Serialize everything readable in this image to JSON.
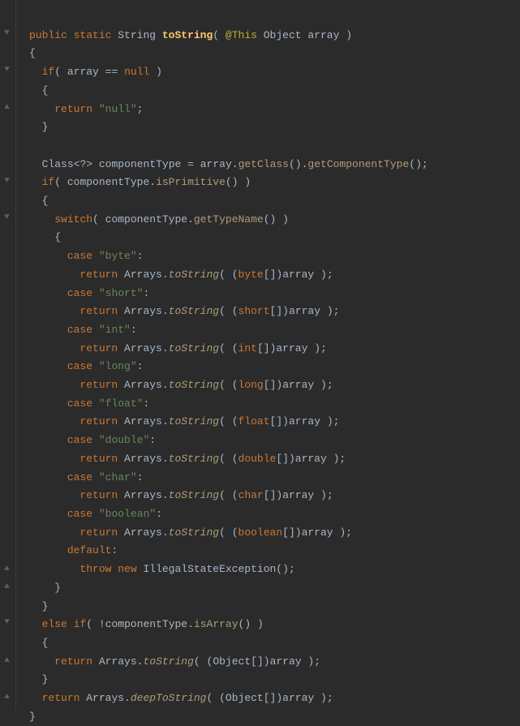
{
  "kw": {
    "public": "public",
    "static": "static",
    "if": "if",
    "else": "else",
    "return": "return",
    "switch": "switch",
    "case": "case",
    "default": "default",
    "throw": "throw",
    "new": "new",
    "null": "null"
  },
  "types": {
    "String": "String",
    "Object": "Object",
    "Class": "Class",
    "byte": "byte",
    "short": "short",
    "int": "int",
    "long": "long",
    "float": "float",
    "double": "double",
    "char": "char",
    "boolean": "boolean",
    "IllegalStateException": "IllegalStateException"
  },
  "ann": {
    "This": "@This"
  },
  "methods": {
    "toString": "toString",
    "getClass": "getClass",
    "getComponentType": "getComponentType",
    "isPrimitive": "isPrimitive",
    "getTypeName": "getTypeName",
    "isArray": "isArray",
    "deepToString": "deepToString"
  },
  "idents": {
    "array": "array",
    "componentType": "componentType",
    "Arrays": "Arrays"
  },
  "strings": {
    "null": "\"null\"",
    "byte": "\"byte\"",
    "short": "\"short\"",
    "int": "\"int\"",
    "long": "\"long\"",
    "float": "\"float\"",
    "double": "\"double\"",
    "char": "\"char\"",
    "boolean": "\"boolean\""
  },
  "punc": {
    "op": "(",
    "cp": ")",
    "ob": "{",
    "cb": "}",
    "obr": "[",
    "cbr": "]",
    "semi": ";",
    "dot": ".",
    "comma": ",",
    "eq": "=",
    "eqeq": "==",
    "lt": "<",
    "gt": ">",
    "q": "?",
    "colon": ":",
    "bang": "!"
  }
}
